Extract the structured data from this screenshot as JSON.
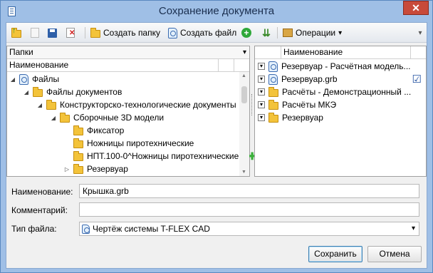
{
  "window": {
    "title": "Сохранение документа",
    "close": "✕"
  },
  "toolbar": {
    "create_folder": "Создать папку",
    "create_file": "Создать файл",
    "operations": "Операции",
    "operations_arrow": "▾",
    "overflow": "▾"
  },
  "folders_pane": {
    "header": "Папки",
    "header_arrow": "▾",
    "column": "Наименование",
    "tree": [
      {
        "label": "Файлы",
        "level": 0,
        "expanded": true,
        "icon": "document-icon"
      },
      {
        "label": "Файлы документов",
        "level": 1,
        "expanded": true,
        "icon": "folder-icon"
      },
      {
        "label": "Конструкторско-технологические документы",
        "level": 2,
        "expanded": true,
        "icon": "folder-icon"
      },
      {
        "label": "Сборочные 3D модели",
        "level": 3,
        "expanded": true,
        "icon": "folder-icon"
      },
      {
        "label": "Фиксатор",
        "level": 4,
        "icon": "folder-icon"
      },
      {
        "label": "Ножницы пиротехнические",
        "level": 4,
        "icon": "folder-icon"
      },
      {
        "label": "НПТ.100-0^Ножницы пиротехнические",
        "level": 4,
        "icon": "folder-icon",
        "badge": "plus-icon"
      },
      {
        "label": "Резервуар",
        "level": 4,
        "expanded": false,
        "icon": "folder-icon"
      }
    ]
  },
  "files_pane": {
    "column": "Наименование",
    "items": [
      {
        "label": "Резервуар - Расчётная модель...",
        "icon": "document-icon"
      },
      {
        "label": "Резервуар.grb",
        "icon": "document-icon",
        "checked": true
      },
      {
        "label": "Расчёты - Демонстрационный ...",
        "icon": "folder-icon"
      },
      {
        "label": "Расчёты МКЭ",
        "icon": "folder-icon"
      },
      {
        "label": "Резервуар",
        "icon": "folder-icon"
      }
    ]
  },
  "form": {
    "name_label": "Наименование:",
    "name_value": "Крышка.grb",
    "comment_label": "Комментарий:",
    "comment_value": "",
    "filetype_label": "Тип файла:",
    "filetype_value": "Чертёж системы T-FLEX CAD",
    "filetype_arrow": "▾"
  },
  "buttons": {
    "save": "Сохранить",
    "cancel": "Отмена"
  },
  "colors": {
    "title_bar": "#9fbfe6",
    "close": "#c84a3a",
    "folder": "#f3c33a",
    "selected_border": "#3c7fb1"
  }
}
